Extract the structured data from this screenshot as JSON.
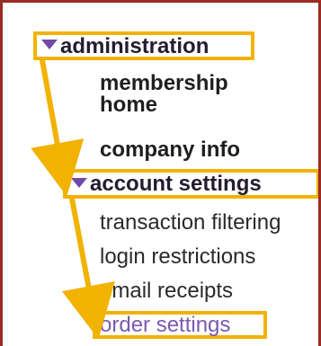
{
  "menu": {
    "administration": {
      "label": "administration",
      "expanded": true
    },
    "items": {
      "membership_home": {
        "line1": "membership",
        "line2": "home"
      },
      "company_info": {
        "label": "company info"
      },
      "account_settings": {
        "label": "account settings",
        "expanded": true
      },
      "subitems": {
        "transaction_filtering": "transaction filtering",
        "login_restrictions": "login restrictions",
        "email_receipts": "email receipts",
        "order_settings": "order settings"
      }
    }
  },
  "colors": {
    "frame_border": "#9c2a25",
    "highlight": "#f2b200",
    "triangle": "#6f4aa6",
    "active_link": "#7a5ab0"
  },
  "icons": {
    "expand": "triangle-down-icon",
    "annotation": "arrow-icon"
  }
}
